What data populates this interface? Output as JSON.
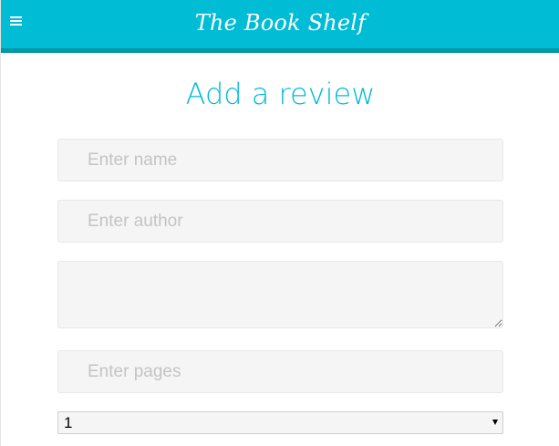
{
  "app": {
    "title": "The Book Shelf"
  },
  "page": {
    "title": "Add a review"
  },
  "form": {
    "name_placeholder": "Enter name",
    "author_placeholder": "Enter author",
    "description_value": "",
    "pages_placeholder": "Enter pages",
    "rating_selected": "1"
  },
  "colors": {
    "accent": "#00bcd4",
    "accent_dark": "#0097a7",
    "field_bg": "#f5f5f5"
  },
  "icons": {
    "menu": "hamburger-menu-icon",
    "select": "dropdown-arrow-icon"
  }
}
